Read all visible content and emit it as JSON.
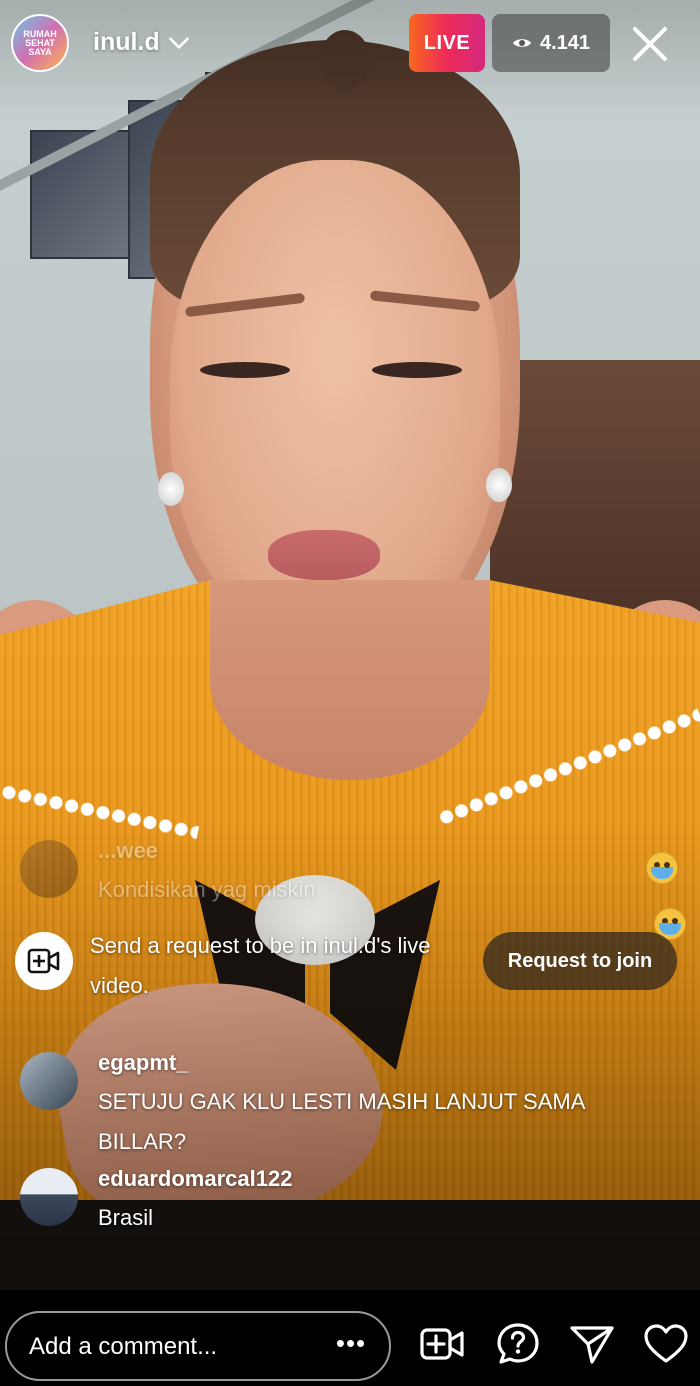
{
  "header": {
    "avatar_text": "RUMAH SEHAT SAYA",
    "username": "inul.d",
    "live_label": "LIVE",
    "viewer_count": "4.141"
  },
  "comments": [
    {
      "username": "...wee",
      "text": "Kondisikan yag miskin"
    },
    {
      "username": "egapmt_",
      "text": "SETUJU GAK KLU LESTI MASIH LANJUT SAMA BILLAR?"
    },
    {
      "username": "eduardomarcal122",
      "text": "Brasil"
    }
  ],
  "join_request": {
    "message": "Send a request to be in inul.d's live video.",
    "button_label": "Request to join"
  },
  "bottom_bar": {
    "comment_placeholder": "Add a comment...",
    "more_label": "•••"
  },
  "icons": {
    "close": "close-icon",
    "eye": "eye-icon",
    "video_add": "video-add-icon",
    "question": "question-icon",
    "send": "send-icon",
    "heart": "heart-icon",
    "reaction": "crying-emoji-icon"
  },
  "colors": {
    "live_gradient": [
      "#f8681d",
      "#ee2a5a",
      "#d3297c"
    ],
    "dress": "#e58f12"
  }
}
